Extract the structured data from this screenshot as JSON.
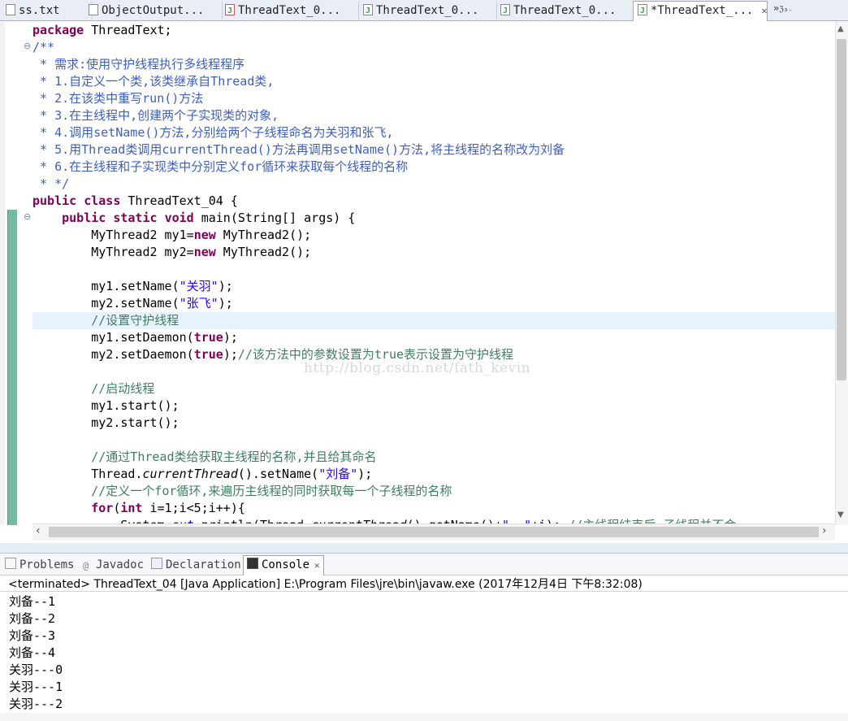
{
  "tabs": [
    {
      "label": "ss.txt",
      "icon": "text-file-icon"
    },
    {
      "label": "ObjectOutput...",
      "icon": "text-file-icon"
    },
    {
      "label": "ThreadText_0...",
      "icon": "java-file-error-icon"
    },
    {
      "label": "ThreadText_0...",
      "icon": "java-file-icon"
    },
    {
      "label": "ThreadText_0...",
      "icon": "java-file-icon"
    },
    {
      "label": "*ThreadText_...",
      "icon": "java-file-icon",
      "active": true
    }
  ],
  "tab_overflow": "»₃₂₃",
  "code_lines": [
    "package ThreadText;",
    "/**",
    " * 需求:使用守护线程执行多线程程序",
    " * 1.自定义一个类,该类继承自Thread类,",
    " * 2.在该类中重写run()方法",
    " * 3.在主线程中,创建两个子实现类的对象,",
    " * 4.调用setName()方法,分别给两个子线程命名为关羽和张飞,",
    " * 5.用Thread类调用currentThread()方法再调用setName()方法,将主线程的名称改为刘备",
    " * 6.在主线程和子实现类中分别定义for循环来获取每个线程的名称",
    " * */",
    "public class ThreadText_04 {",
    "    public static void main(String[] args) {",
    "        MyThread2 my1=new MyThread2();",
    "        MyThread2 my2=new MyThread2();",
    "",
    "        my1.setName(\"关羽\");",
    "        my2.setName(\"张飞\");",
    "        //设置守护线程",
    "        my1.setDaemon(true);",
    "        my2.setDaemon(true);//该方法中的参数设置为true表示设置为守护线程",
    "",
    "        //启动线程",
    "        my1.start();",
    "        my2.start();",
    "",
    "        //通过Thread类给获取主线程的名称,并且给其命名",
    "        Thread.currentThread().setName(\"刘备\");",
    "        //定义一个for循环,来遍历主线程的同时获取每一个子线程的名称",
    "        for(int i=1;i<5;i++){",
    "            System.out.println(Thread.currentThread().getName()+\"--\"+i); //主线程结束后,子线程并不会"
  ],
  "watermark": "http://blog.csdn.net/fath_kevin",
  "panel_tabs": [
    {
      "label": "Problems",
      "icon": "problems-icon"
    },
    {
      "label": "Javadoc",
      "icon": "javadoc-icon"
    },
    {
      "label": "Declaration",
      "icon": "declaration-icon"
    },
    {
      "label": "Console",
      "icon": "console-icon",
      "active": true
    }
  ],
  "console_header": "<terminated> ThreadText_04 [Java Application] E:\\Program Files\\jre\\bin\\javaw.exe (2017年12月4日 下午8:32:08)",
  "console_output": [
    "刘备--1",
    "刘备--2",
    "刘备--3",
    "刘备--4",
    "关羽---0",
    "关羽---1",
    "关羽---2"
  ],
  "colors": {
    "keyword": "#7f0055",
    "javadoc": "#3f5fbf",
    "line_comment": "#3f7f5f",
    "string": "#2a00ff",
    "current_line": "#e8f2fe",
    "change_bar": "#76b8a4"
  }
}
